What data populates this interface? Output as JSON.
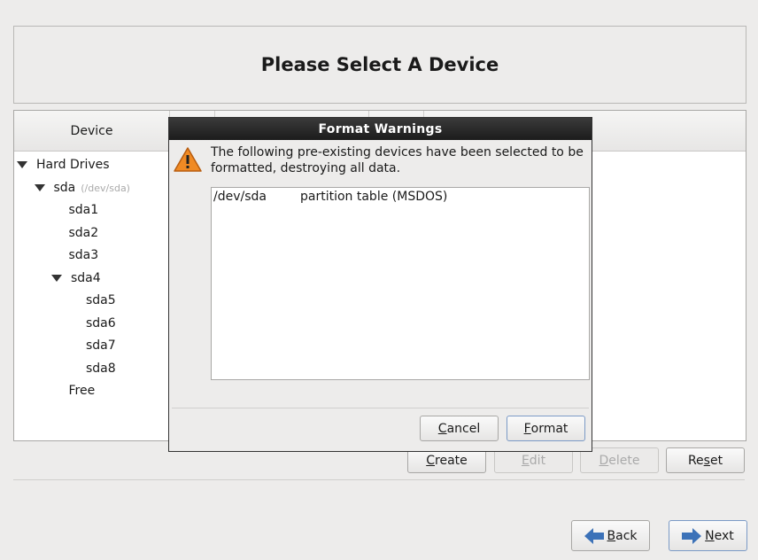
{
  "header": {
    "title": "Please Select A Device"
  },
  "tree": {
    "column_device": "Device",
    "rows": [
      {
        "label": "Hard Drives",
        "expanded": true
      },
      {
        "label": "sda",
        "sub": "(/dev/sda)",
        "expanded": true
      },
      {
        "label": "sda1"
      },
      {
        "label": "sda2"
      },
      {
        "label": "sda3"
      },
      {
        "label": "sda4",
        "expanded": true
      },
      {
        "label": "sda5"
      },
      {
        "label": "sda6"
      },
      {
        "label": "sda7"
      },
      {
        "label": "sda8"
      },
      {
        "label": "Free"
      }
    ]
  },
  "actions": {
    "create": "reate",
    "create_key": "C",
    "edit": "dit",
    "edit_key": "E",
    "delete": "elete",
    "delete_key": "D",
    "reset_pre": "Re",
    "reset_key": "s",
    "reset_post": "et"
  },
  "nav": {
    "back_key": "B",
    "back": "ack",
    "next_key": "N",
    "next": "ext"
  },
  "dialog": {
    "title": "Format Warnings",
    "message": "The following pre-existing devices have been selected to be formatted, destroying all data.",
    "items": [
      {
        "device": "/dev/sda",
        "description": "partition table (MSDOS)"
      }
    ],
    "cancel_key": "C",
    "cancel": "ancel",
    "format_key": "F",
    "format": "ormat"
  },
  "colors": {
    "warning": "#f08a24",
    "arrow": "#3c72b8",
    "titlebar": "#262626"
  }
}
